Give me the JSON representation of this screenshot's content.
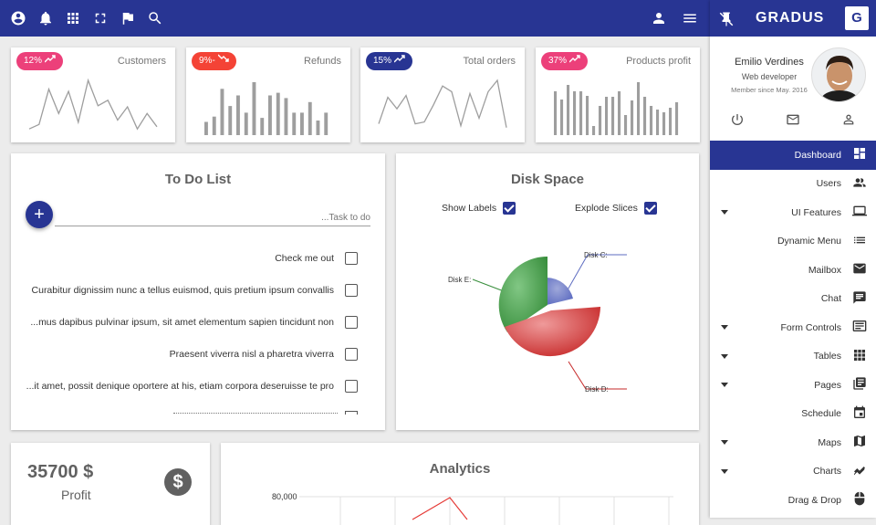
{
  "topbar": {
    "left_icons": [
      "account-circle-icon",
      "bell-icon",
      "apps-grid-icon",
      "fullscreen-icon",
      "flag-icon",
      "search-icon"
    ],
    "right_icons": [
      "person-icon",
      "menu-icon"
    ]
  },
  "stats": [
    {
      "badge": "12%",
      "trend": "up",
      "color": "#ec407a",
      "title": "Customers",
      "kind": "line",
      "values": [
        4,
        8,
        40,
        18,
        38,
        10,
        48,
        25,
        30,
        12,
        24,
        4,
        18,
        6
      ]
    },
    {
      "badge": "9%-",
      "trend": "down",
      "color": "#f44336",
      "title": "Refunds",
      "kind": "bar",
      "values": [
        10,
        14,
        35,
        22,
        30,
        17,
        40,
        13,
        30,
        32,
        28,
        17,
        17,
        25,
        11,
        17
      ]
    },
    {
      "badge": "15%",
      "trend": "up",
      "color": "#283593",
      "title": "Total orders",
      "kind": "line",
      "values": [
        10,
        38,
        26,
        40,
        10,
        12,
        30,
        50,
        44,
        8,
        42,
        16,
        44,
        56,
        6
      ]
    },
    {
      "badge": "37%",
      "trend": "up",
      "color": "#ec407a",
      "title": "Products profit",
      "kind": "bar",
      "values": [
        48,
        39,
        55,
        48,
        48,
        43,
        10,
        32,
        42,
        42,
        48,
        22,
        38,
        58,
        42,
        32,
        28,
        25,
        30,
        36
      ]
    }
  ],
  "todo": {
    "title": "To Do List",
    "add_button": "+",
    "placeholder": "...Task to do",
    "items": [
      {
        "text": "Check me out",
        "checked": false
      },
      {
        "text": "Curabitur dignissim nunc a tellus euismod, quis pretium ipsum convallis",
        "checked": false
      },
      {
        "text": "...mus dapibus pulvinar ipsum, sit amet elementum sapien tincidunt non",
        "checked": false
      },
      {
        "text": "Praesent viverra nisl a pharetra viverra",
        "checked": false
      },
      {
        "text": "...it amet, possit denique oportere at his, etiam corpora deseruisse te pro",
        "checked": false
      }
    ]
  },
  "disk": {
    "title": "Disk Space",
    "show_labels": "Show Labels",
    "explode_slices": "Explode Slices",
    "labels": {
      "c": "Disk C:",
      "e": "Disk E:",
      "d": "Disk D:"
    },
    "colors": {
      "c": "#7986cb",
      "e": "#4caf50",
      "d": "#e53935"
    }
  },
  "profit": {
    "value": "35700 $",
    "label": "Profit",
    "icon": "dollar-icon"
  },
  "analytics": {
    "title": "Analytics",
    "y_tick": "80,000"
  },
  "sidebar": {
    "brand": "GRADUS",
    "brand_letter": "G",
    "user_name": "Emilio Verdines",
    "user_role": "Web developer",
    "member_since": "Member since May. 2016",
    "actions": [
      "power-icon",
      "mail-icon",
      "person-icon"
    ],
    "menu": [
      {
        "label": "Dashboard",
        "icon": "dashboard-icon",
        "active": true,
        "caret": false
      },
      {
        "label": "Users",
        "icon": "users-icon",
        "active": false,
        "caret": false
      },
      {
        "label": "UI Features",
        "icon": "laptop-icon",
        "active": false,
        "caret": true
      },
      {
        "label": "Dynamic Menu",
        "icon": "list-icon",
        "active": false,
        "caret": false
      },
      {
        "label": "Mailbox",
        "icon": "mail-icon",
        "active": false,
        "caret": false
      },
      {
        "label": "Chat",
        "icon": "chat-icon",
        "active": false,
        "caret": false
      },
      {
        "label": "Form Controls",
        "icon": "form-icon",
        "active": false,
        "caret": true
      },
      {
        "label": "Tables",
        "icon": "grid-icon",
        "active": false,
        "caret": true
      },
      {
        "label": "Pages",
        "icon": "pages-icon",
        "active": false,
        "caret": true
      },
      {
        "label": "Schedule",
        "icon": "calendar-icon",
        "active": false,
        "caret": false
      },
      {
        "label": "Maps",
        "icon": "map-icon",
        "active": false,
        "caret": true
      },
      {
        "label": "Charts",
        "icon": "charts-icon",
        "active": false,
        "caret": true
      },
      {
        "label": "Drag & Drop",
        "icon": "mouse-icon",
        "active": false,
        "caret": false
      }
    ]
  }
}
